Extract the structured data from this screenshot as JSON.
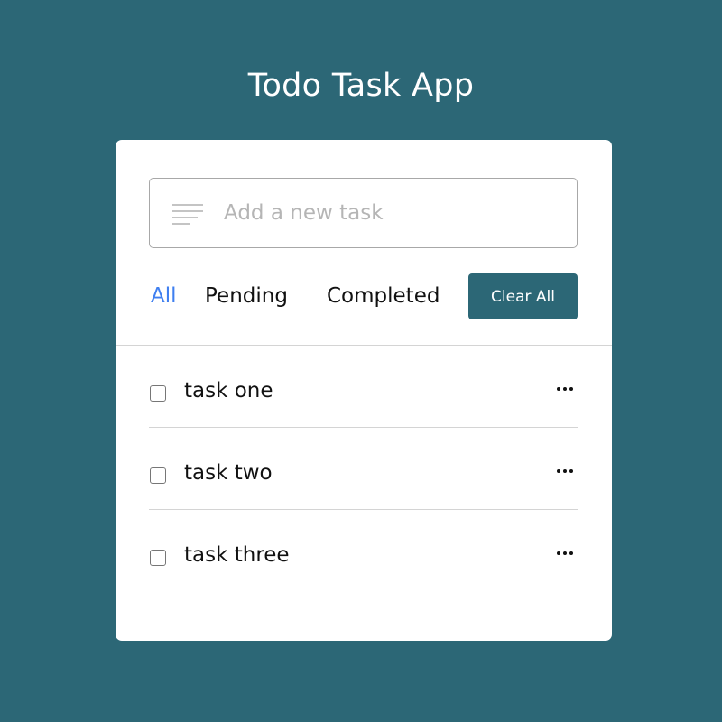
{
  "app": {
    "title": "Todo Task App"
  },
  "input": {
    "placeholder": "Add a new task",
    "value": "",
    "icon": "lines-icon"
  },
  "filters": [
    {
      "label": "All",
      "active": true
    },
    {
      "label": "Pending",
      "active": false
    },
    {
      "label": "Completed",
      "active": false
    }
  ],
  "clear_button": {
    "label": "Clear All"
  },
  "tasks": [
    {
      "label": "task one",
      "completed": false,
      "menu_icon": "more-icon"
    },
    {
      "label": "task two",
      "completed": false,
      "menu_icon": "more-icon"
    },
    {
      "label": "task three",
      "completed": false,
      "menu_icon": "more-icon"
    }
  ],
  "colors": {
    "background": "#2c6776",
    "accent": "#2c6776",
    "active_filter": "#3f7ff0",
    "card": "#ffffff"
  }
}
